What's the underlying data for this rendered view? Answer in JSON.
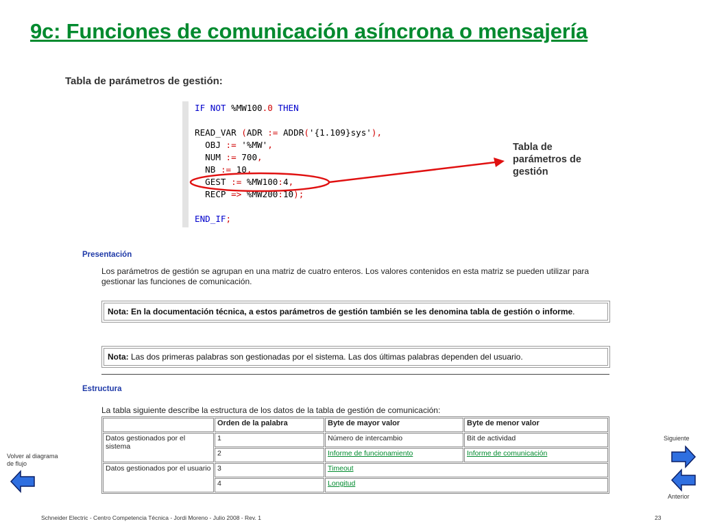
{
  "slide": {
    "title": "9c: Funciones de comunicación asíncrona o mensajería",
    "subtitle": "Tabla de parámetros de gestión:",
    "callout": "Tabla de parámetros de gestión",
    "footer": "Schneider Electric  - Centro Competencia Técnica - Jordi Moreno - Julio 2008 - Rev. 1",
    "page_number": "23"
  },
  "code": {
    "line1": {
      "kw1": "IF",
      "kw2": "NOT",
      "var": "%MW100",
      "bit": ".0",
      "kw3": "THEN"
    },
    "line2": {
      "fn": "READ_VAR",
      "p1": "(",
      "adr": "ADR",
      "as1": ":=",
      "addr": "ADDR",
      "p2": "(",
      "str": "'{1.109}sys'",
      "p3": "),"
    },
    "line3": {
      "name": "OBJ",
      "as": ":=",
      "val": "'%MW'",
      "end": ","
    },
    "line4": {
      "name": "NUM",
      "as": ":=",
      "val": "700",
      "end": ","
    },
    "line5": {
      "name": "NB",
      "as": ":=",
      "val": "10",
      "end": ","
    },
    "line6": {
      "name": "GEST",
      "as": ":=",
      "val": "%MW100",
      "colon": ":",
      "num": "4",
      "end": ","
    },
    "line7": {
      "name": "RECP",
      "as": "=>",
      "val": "%MW200",
      "colon": ":",
      "num": "10",
      "end": ");"
    },
    "line8": {
      "kw": "END_IF",
      "end": ";"
    }
  },
  "presentation": {
    "heading": "Presentación",
    "paragraph": "Los parámetros de gestión se agrupan en una matriz de cuatro enteros. Los valores contenidos en esta matriz se pueden utilizar para gestionar las funciones de comunicación.",
    "note1": "Nota: En la documentación técnica, a estos parámetros de gestión también se les denomina tabla de gestión o informe",
    "note1_end": ".",
    "note2_label": "Nota:",
    "note2_text": " Las dos primeras palabras son gestionadas por el sistema. Las dos últimas palabras dependen del usuario."
  },
  "structure": {
    "heading": "Estructura",
    "intro": "La tabla siguiente describe la estructura de los datos de la tabla de gestión de comunicación:",
    "headers": [
      "",
      "Orden de la palabra",
      "Byte de mayor valor",
      "Byte de menor valor"
    ],
    "group1": "Datos gestionados por el sistema",
    "group2": "Datos gestionados por el usuario",
    "rows": [
      {
        "order": "1",
        "high": "Número de intercambio",
        "low": "Bit de actividad"
      },
      {
        "order": "2",
        "high": "Informe de funcionamiento",
        "low": "Informe de comunicación"
      },
      {
        "order": "3",
        "high": "Timeout"
      },
      {
        "order": "4",
        "high": "Longitud"
      }
    ]
  },
  "nav": {
    "back_label": "Volver al diagrama de flujo",
    "next_label": "Siguiente",
    "prev_label": "Anterior",
    "arrow_fill": "#2f6fe0"
  }
}
